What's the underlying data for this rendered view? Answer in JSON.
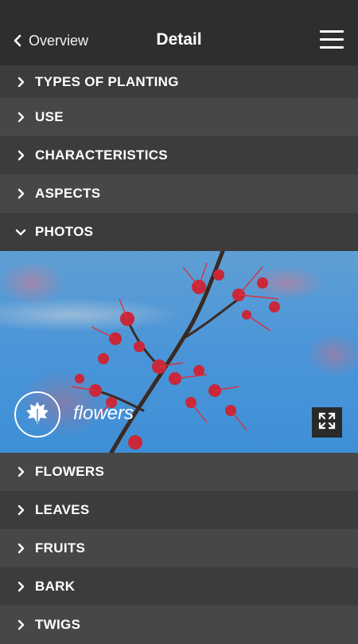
{
  "header": {
    "back_label": "Overview",
    "title": "Detail",
    "back_icon": "chevron-left-icon",
    "menu_icon": "hamburger-menu-icon"
  },
  "sections_top": [
    {
      "label": "TYPES OF PLANTING",
      "expanded": false
    },
    {
      "label": "USE",
      "expanded": false
    },
    {
      "label": "CHARACTERISTICS",
      "expanded": false
    },
    {
      "label": "ASPECTS",
      "expanded": false
    },
    {
      "label": "PHOTOS",
      "expanded": true
    }
  ],
  "photo": {
    "caption": "flowers",
    "badge_icon": "leaf-icon",
    "expand_icon": "fullscreen-icon"
  },
  "sections_bottom": [
    {
      "label": "FLOWERS",
      "expanded": false
    },
    {
      "label": "LEAVES",
      "expanded": false
    },
    {
      "label": "FRUITS",
      "expanded": false
    },
    {
      "label": "BARK",
      "expanded": false
    },
    {
      "label": "TWIGS",
      "expanded": false
    }
  ],
  "colors": {
    "header_bg": "#2e2e2e",
    "row_dark": "#3c3c3c",
    "row_light": "#474747",
    "text": "#ffffff"
  }
}
